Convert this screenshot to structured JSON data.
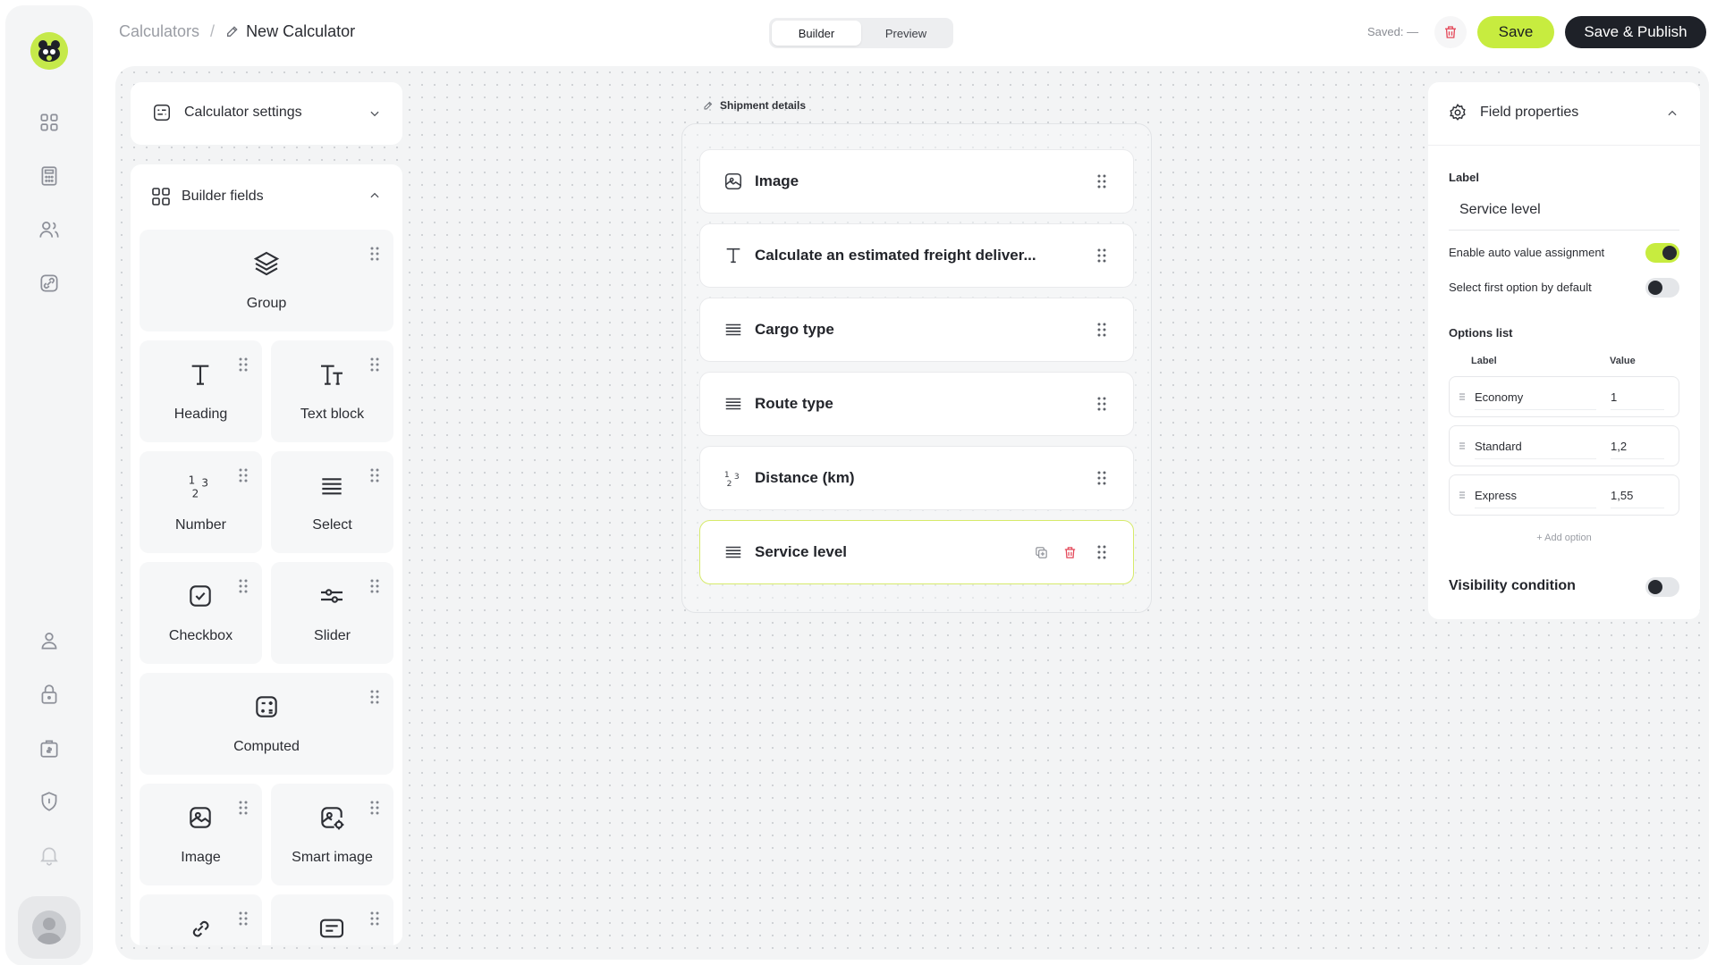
{
  "breadcrumb": {
    "root": "Calculators",
    "separator": "/",
    "current": "New Calculator"
  },
  "mode_tabs": [
    {
      "label": "Builder",
      "active": true
    },
    {
      "label": "Preview",
      "active": false
    }
  ],
  "header": {
    "saved_status": "Saved: —",
    "save_label": "Save",
    "publish_label": "Save & Publish"
  },
  "left_panel": {
    "settings_title": "Calculator settings",
    "fields_title": "Builder fields",
    "fields": [
      {
        "label": "Group",
        "icon": "layers-icon"
      },
      {
        "label": "Heading",
        "icon": "heading-icon"
      },
      {
        "label": "Text block",
        "icon": "text-block-icon"
      },
      {
        "label": "Number",
        "icon": "number-icon"
      },
      {
        "label": "Select",
        "icon": "select-icon"
      },
      {
        "label": "Checkbox",
        "icon": "checkbox-icon"
      },
      {
        "label": "Slider",
        "icon": "slider-icon"
      },
      {
        "label": "Computed",
        "icon": "calculator-icon"
      },
      {
        "label": "Image",
        "icon": "image-icon"
      },
      {
        "label": "Smart image",
        "icon": "smart-image-icon"
      }
    ]
  },
  "canvas": {
    "group_title": "Shipment details",
    "rows": [
      {
        "label": "Image",
        "icon": "image-icon"
      },
      {
        "label": "Calculate an estimated freight deliver...",
        "icon": "heading-icon"
      },
      {
        "label": "Cargo type",
        "icon": "select-icon"
      },
      {
        "label": "Route type",
        "icon": "select-icon"
      },
      {
        "label": "Distance (km)",
        "icon": "number-icon"
      },
      {
        "label": "Service level",
        "icon": "select-icon",
        "selected": true
      }
    ]
  },
  "properties": {
    "title": "Field properties",
    "label_caption": "Label",
    "label_value": "Service level",
    "toggles": [
      {
        "label": "Enable auto value assignment",
        "on": true
      },
      {
        "label": "Select first option by default",
        "on": false
      }
    ],
    "options_title": "Options list",
    "col_label": "Label",
    "col_value": "Value",
    "options": [
      {
        "label": "Economy",
        "value": "1"
      },
      {
        "label": "Standard",
        "value": "1,2"
      },
      {
        "label": "Express",
        "value": "1,55"
      }
    ],
    "add_option": "+ Add option",
    "visibility_title": "Visibility condition",
    "visibility_on": false
  },
  "colors": {
    "accent": "#c7ec3f",
    "dark": "#1e2128",
    "danger": "#e4495a"
  }
}
